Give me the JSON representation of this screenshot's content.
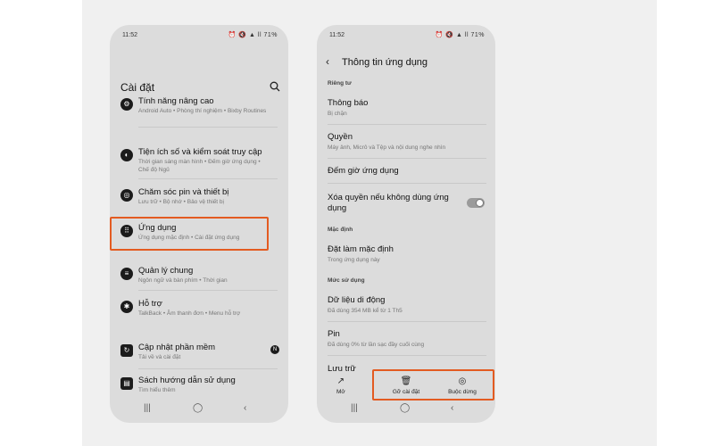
{
  "left_phone": {
    "status": {
      "time": "11:52",
      "right": "⏰ 🔇 ▲ ll 71%"
    },
    "title": "Cài đặt",
    "items": [
      {
        "title": "Tính năng nâng cao",
        "subtitle": "Android Auto • Phòng thí nghiệm • Bixby Routines",
        "icon": "gear-plus-icon"
      },
      {
        "title": "Tiện ích số và kiểm soát truy cập",
        "subtitle": "Thời gian sáng màn hình • Đếm giờ ứng dụng • Chế độ Ngủ",
        "icon": "digital-wellbeing-icon"
      },
      {
        "title": "Chăm sóc pin và thiết bị",
        "subtitle": "Lưu trữ • Bộ nhớ • Bảo vệ thiết bị",
        "icon": "device-care-icon"
      },
      {
        "title": "Ứng dụng",
        "subtitle": "Ứng dụng mặc định • Cài đặt ứng dụng",
        "icon": "apps-grid-icon"
      },
      {
        "title": "Quản lý chung",
        "subtitle": "Ngôn ngữ và bàn phím • Thời gian",
        "icon": "general-management-icon"
      },
      {
        "title": "Hỗ trợ",
        "subtitle": "TalkBack • Âm thanh đơn • Menu hỗ trợ",
        "icon": "accessibility-icon"
      },
      {
        "title": "Cập nhật phần mềm",
        "subtitle": "Tải về và cài đặt",
        "icon": "software-update-icon",
        "badge": "N"
      },
      {
        "title": "Sách hướng dẫn sử dụng",
        "subtitle": "Tìm hiểu thêm",
        "icon": "user-manual-icon"
      }
    ]
  },
  "right_phone": {
    "status": {
      "time": "11:52",
      "right": "⏰ 🔇 ▲ ll 71%"
    },
    "title": "Thông tin ứng dụng",
    "sections": {
      "privacy": "Riêng tư",
      "defaults": "Mặc định",
      "usage": "Mức sử dụng"
    },
    "rows": {
      "notifications": {
        "title": "Thông báo",
        "subtitle": "Bị chặn"
      },
      "permissions": {
        "title": "Quyền",
        "subtitle": "Máy ảnh, Micrô và Tệp và nội dung nghe nhìn"
      },
      "screen_time": {
        "title": "Đếm giờ ứng dụng"
      },
      "remove_permissions": {
        "title": "Xóa quyền nếu không dùng ứng dụng",
        "toggle_on": true
      },
      "set_default": {
        "title": "Đặt làm mặc định",
        "subtitle": "Trong ứng dụng này"
      },
      "mobile_data": {
        "title": "Dữ liệu di động",
        "subtitle": "Đã dùng 354 MB kể từ 1 Th5"
      },
      "battery": {
        "title": "Pin",
        "subtitle": "Đã dùng 0% từ lần sạc đầy cuối cùng"
      },
      "storage": {
        "title": "Lưu trữ"
      }
    },
    "bottom_actions": {
      "open": "Mở",
      "uninstall": "Gỡ cài đặt",
      "force_stop": "Buộc dừng"
    }
  },
  "colors": {
    "highlight": "#e35b21",
    "phone_bg": "#dcdcdc"
  }
}
